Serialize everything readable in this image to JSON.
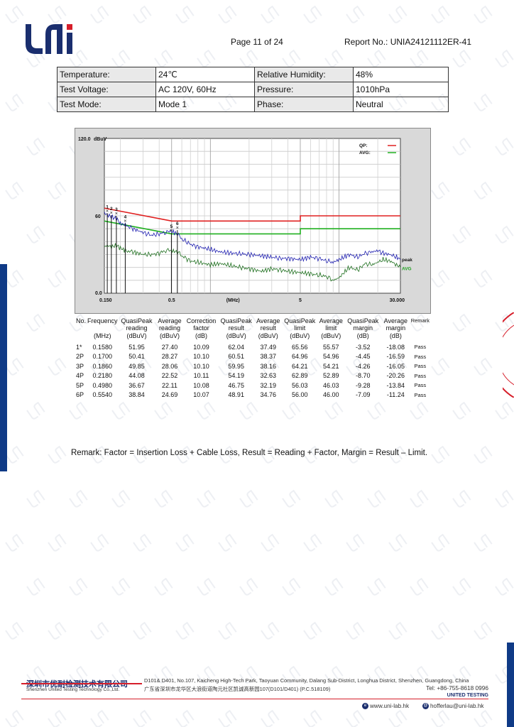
{
  "header": {
    "logo_text": "UNi",
    "page_label": "Page 11 of 24",
    "report_no": "Report No.: UNIA24121112ER-41"
  },
  "conditions": {
    "temperature_label": "Temperature:",
    "temperature_value": "24℃",
    "humidity_label": "Relative Humidity:",
    "humidity_value": "48%",
    "voltage_label": "Test Voltage:",
    "voltage_value": "AC 120V, 60Hz",
    "pressure_label": "Pressure:",
    "pressure_value": "1010hPa",
    "mode_label": "Test Mode:",
    "mode_value": "Mode 1",
    "phase_label": "Phase:",
    "phase_value": "Neutral"
  },
  "chart_data": {
    "type": "line",
    "y_top_label": "120.0",
    "y_unit": "dBuV",
    "y_mid_label": "60",
    "y_bottom_label": "0.0",
    "x_unit": "(MHz)",
    "x_tick_labels": [
      "0.150",
      "0.5",
      "5",
      "30.000"
    ],
    "xlim": [
      0.15,
      30
    ],
    "ylim": [
      0,
      120
    ],
    "x_scale": "log",
    "grid": true,
    "legend_placement": "top-right",
    "legend": [
      {
        "label": "QP:",
        "color": "#e02020"
      },
      {
        "label": "AVG:",
        "color": "#20b020"
      }
    ],
    "trace_labels": {
      "peak": "peak",
      "avg": "AVG"
    },
    "series": [
      {
        "name": "QP limit",
        "color": "#e02020",
        "x": [
          0.15,
          0.5,
          0.5,
          5,
          5,
          30
        ],
        "y": [
          66,
          56,
          56,
          56,
          60,
          60
        ]
      },
      {
        "name": "AVG limit",
        "color": "#20b020",
        "x": [
          0.15,
          0.5,
          0.5,
          5,
          5,
          30
        ],
        "y": [
          56,
          46,
          46,
          46,
          50,
          50
        ]
      },
      {
        "name": "peak",
        "color": "#2020b0",
        "x": [
          0.15,
          0.158,
          0.17,
          0.186,
          0.2,
          0.218,
          0.25,
          0.3,
          0.35,
          0.4,
          0.45,
          0.498,
          0.554,
          0.6,
          0.7,
          0.8,
          1.0,
          1.2,
          1.5,
          2.0,
          2.5,
          3.0,
          3.5,
          4.0,
          5.0,
          6.0,
          7.0,
          8.0,
          9.0,
          10.0,
          12.0,
          14.0,
          16.0,
          18.0,
          20.0,
          22.0,
          25.0,
          28.0,
          30.0
        ],
        "y": [
          62,
          61,
          59,
          58,
          54,
          53,
          50,
          47,
          45,
          46,
          47,
          48,
          46,
          42,
          38,
          36,
          34,
          32,
          31,
          30,
          29,
          28,
          27,
          27,
          26,
          28,
          27,
          25,
          24,
          26,
          30,
          28,
          31,
          32,
          33,
          31,
          30,
          28,
          26
        ]
      },
      {
        "name": "AVG",
        "color": "#207020",
        "x": [
          0.15,
          0.158,
          0.17,
          0.186,
          0.2,
          0.218,
          0.25,
          0.3,
          0.35,
          0.4,
          0.45,
          0.498,
          0.554,
          0.6,
          0.7,
          0.8,
          1.0,
          1.2,
          1.5,
          2.0,
          2.5,
          3.0,
          3.5,
          4.0,
          5.0,
          6.0,
          7.0,
          8.0,
          9.0,
          10.0,
          12.0,
          14.0,
          16.0,
          18.0,
          20.0,
          22.0,
          25.0,
          28.0,
          30.0
        ],
        "y": [
          36,
          37,
          36,
          37,
          35,
          33,
          32,
          30,
          30,
          31,
          33,
          33,
          32,
          29,
          25,
          24,
          22,
          23,
          21,
          19,
          17,
          19,
          18,
          17,
          16,
          15,
          14,
          13,
          10,
          12,
          20,
          18,
          23,
          22,
          24,
          26,
          25,
          22,
          20
        ]
      }
    ],
    "markers": [
      {
        "label": "1",
        "x": 0.158,
        "y": 62.04
      },
      {
        "label": "2",
        "x": 0.17,
        "y": 60.51
      },
      {
        "label": "3",
        "x": 0.186,
        "y": 59.95
      },
      {
        "label": "4",
        "x": 0.218,
        "y": 54.19
      },
      {
        "label": "5",
        "x": 0.498,
        "y": 46.75
      },
      {
        "label": "6",
        "x": 0.554,
        "y": 48.91
      }
    ]
  },
  "results": {
    "headers": [
      "No.",
      "Frequency",
      "QuasiPeak reading",
      "Average reading",
      "Correction factor",
      "QuasiPeak result",
      "Average result",
      "QuasiPeak limit",
      "Average limit",
      "QuasiPeak margin",
      "Average margin",
      "Remark"
    ],
    "units": [
      "",
      "(MHz)",
      "(dBuV)",
      "(dBuV)",
      "(dB)",
      "(dBuV)",
      "(dBuV)",
      "(dBuV)",
      "(dBuV)",
      "(dB)",
      "(dB)",
      ""
    ],
    "rows": [
      [
        "1*",
        "0.1580",
        "51.95",
        "27.40",
        "10.09",
        "62.04",
        "37.49",
        "65.56",
        "55.57",
        "-3.52",
        "-18.08",
        "Pass"
      ],
      [
        "2P",
        "0.1700",
        "50.41",
        "28.27",
        "10.10",
        "60.51",
        "38.37",
        "64.96",
        "54.96",
        "-4.45",
        "-16.59",
        "Pass"
      ],
      [
        "3P",
        "0.1860",
        "49.85",
        "28.06",
        "10.10",
        "59.95",
        "38.16",
        "64.21",
        "54.21",
        "-4.26",
        "-16.05",
        "Pass"
      ],
      [
        "4P",
        "0.2180",
        "44.08",
        "22.52",
        "10.11",
        "54.19",
        "32.63",
        "62.89",
        "52.89",
        "-8.70",
        "-20.26",
        "Pass"
      ],
      [
        "5P",
        "0.4980",
        "36.67",
        "22.11",
        "10.08",
        "46.75",
        "32.19",
        "56.03",
        "46.03",
        "-9.28",
        "-13.84",
        "Pass"
      ],
      [
        "6P",
        "0.5540",
        "38.84",
        "24.69",
        "10.07",
        "48.91",
        "34.76",
        "56.00",
        "46.00",
        "-7.09",
        "-11.24",
        "Pass"
      ]
    ]
  },
  "remark": "Remark: Factor = Insertion Loss + Cable Loss, Result = Reading + Factor, Margin = Result – Limit.",
  "footer": {
    "company_cn": "深圳市优耐检测技术有限公司",
    "company_en": "Shenzhen United Testing Technology Co.,Ltd.",
    "address_en": "D101& D401, No.107, Kaicheng High-Tech Park, Taoyuan Community, Dalang Sub-District, Longhua District, Shenzhen, Guangdong, China",
    "address_cn": "广东省深圳市龙华区大浪街道陶元社区凯诚高新园107(D101/D401) (P.C.518109)",
    "tel": "Tel: +86-755-8618 0996",
    "brand": "UNITED TESTING",
    "website": "www.uni-lab.hk",
    "email": "hofferlau@uni-lab.hk"
  },
  "colors": {
    "brand_blue": "#1a2e6e",
    "brand_red": "#d61e2a"
  }
}
